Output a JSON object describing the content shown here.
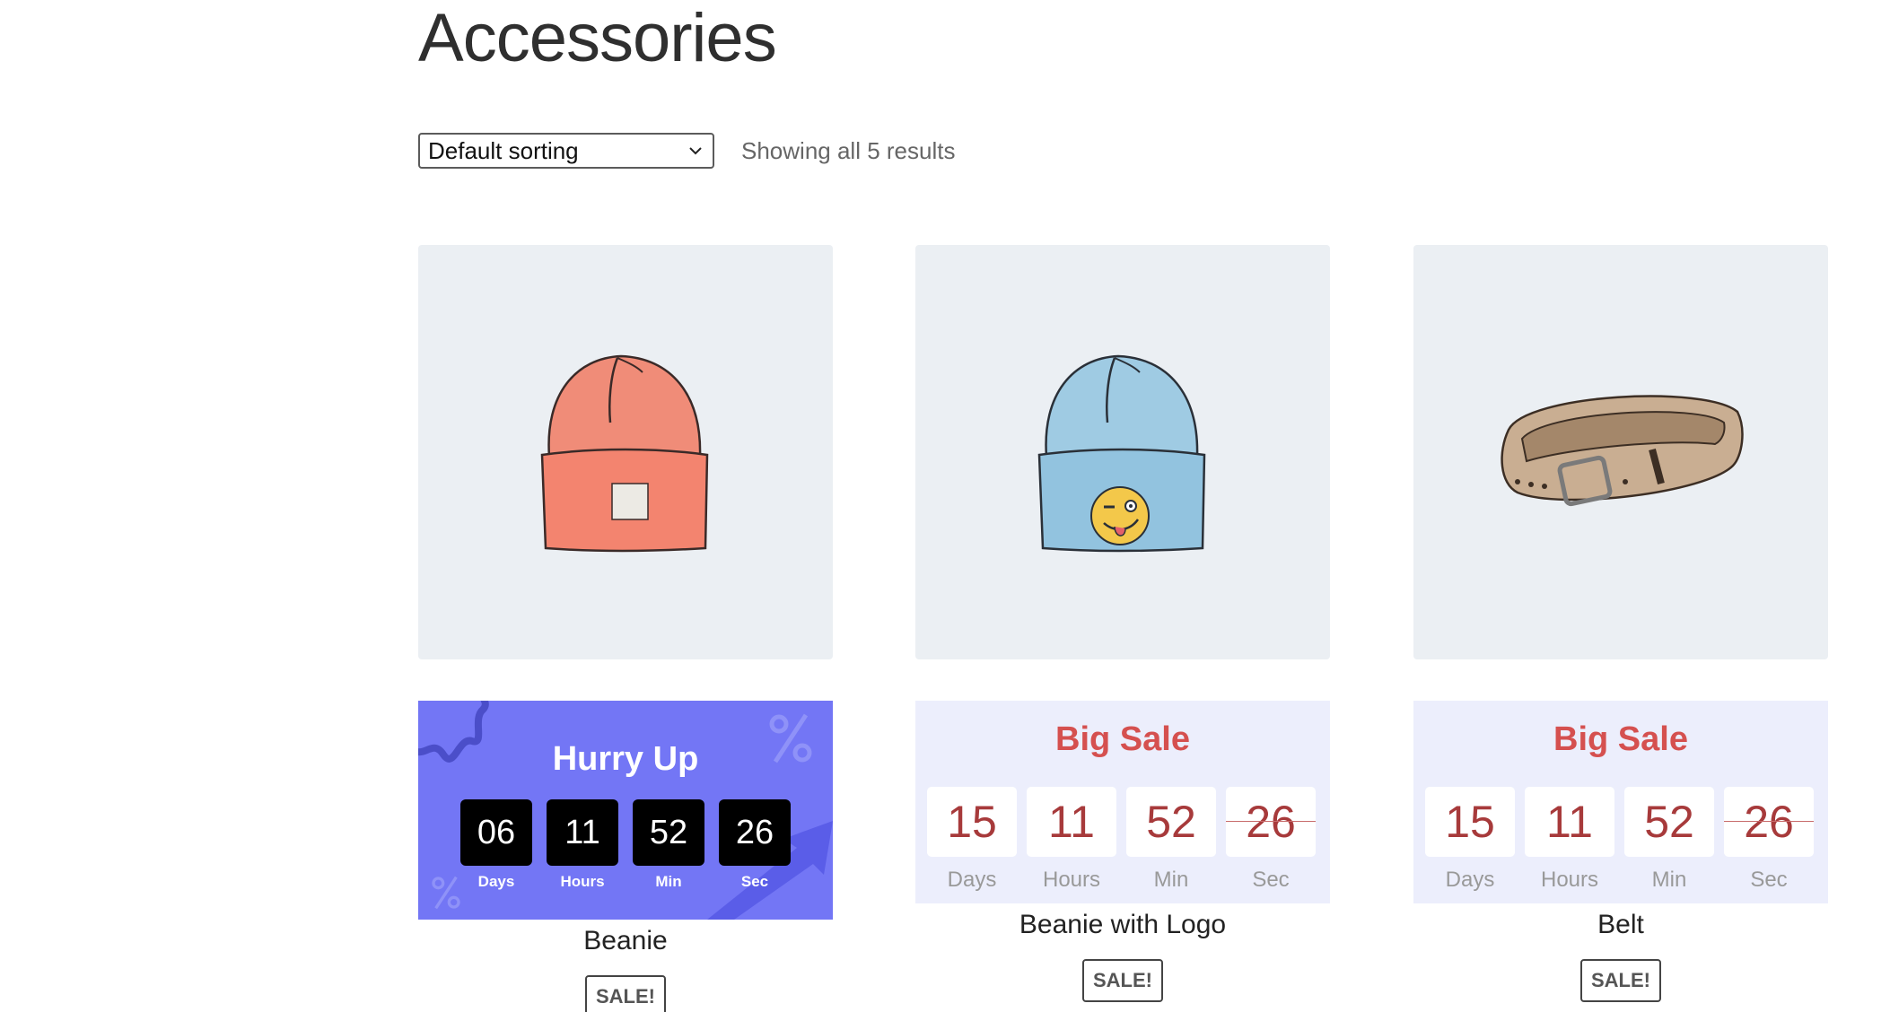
{
  "page_title": "Accessories",
  "sorting": {
    "selected": "Default sorting"
  },
  "results_count": "Showing all 5 results",
  "products": [
    {
      "name": "Beanie",
      "badge": "SALE!",
      "image_icon": "orange-beanie-icon",
      "countdown": {
        "style": "purple",
        "heading": "Hurry Up",
        "units": [
          {
            "value": "06",
            "label": "Days"
          },
          {
            "value": "11",
            "label": "Hours"
          },
          {
            "value": "52",
            "label": "Min"
          },
          {
            "value": "26",
            "label": "Sec"
          }
        ]
      }
    },
    {
      "name": "Beanie with Logo",
      "badge": "SALE!",
      "image_icon": "blue-beanie-with-logo-icon",
      "countdown": {
        "style": "light",
        "heading": "Big Sale",
        "units": [
          {
            "value": "15",
            "label": "Days"
          },
          {
            "value": "11",
            "label": "Hours"
          },
          {
            "value": "52",
            "label": "Min"
          },
          {
            "value": "26",
            "label": "Sec"
          }
        ]
      }
    },
    {
      "name": "Belt",
      "badge": "SALE!",
      "image_icon": "belt-icon",
      "countdown": {
        "style": "light",
        "heading": "Big Sale",
        "units": [
          {
            "value": "15",
            "label": "Days"
          },
          {
            "value": "11",
            "label": "Hours"
          },
          {
            "value": "52",
            "label": "Min"
          },
          {
            "value": "26",
            "label": "Sec"
          }
        ]
      }
    }
  ],
  "colors": {
    "purple_timer_bg": "#7376f5",
    "light_timer_bg": "#eceefc",
    "sale_heading": "#d5504f",
    "image_bg": "#ebeff3"
  }
}
